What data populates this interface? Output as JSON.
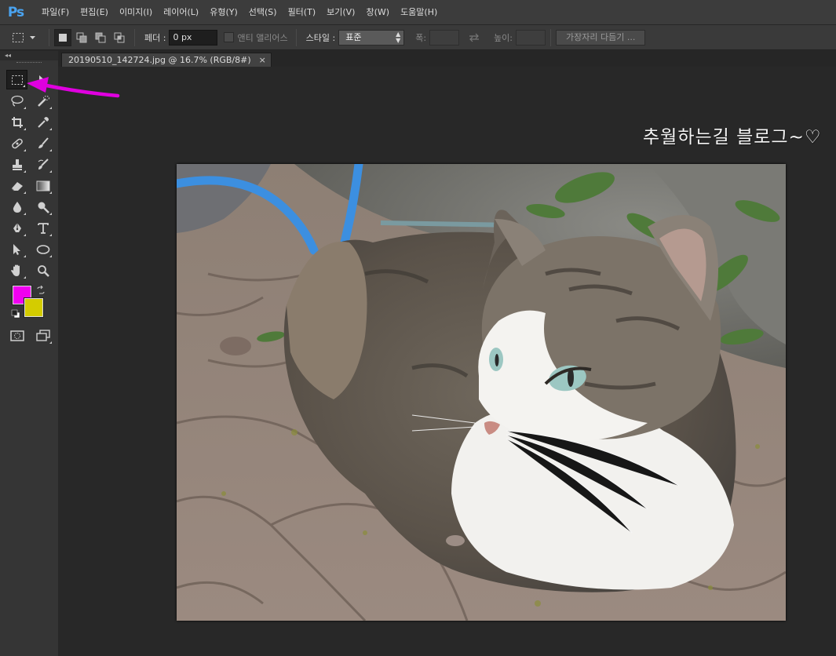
{
  "app": {
    "logo": "Ps"
  },
  "menu": [
    {
      "label": "파일(F)"
    },
    {
      "label": "편집(E)"
    },
    {
      "label": "이미지(I)"
    },
    {
      "label": "레이어(L)"
    },
    {
      "label": "유형(Y)"
    },
    {
      "label": "선택(S)"
    },
    {
      "label": "필터(T)"
    },
    {
      "label": "보기(V)"
    },
    {
      "label": "창(W)"
    },
    {
      "label": "도움말(H)"
    }
  ],
  "options": {
    "feather_label": "페더 :",
    "feather_value": "0 px",
    "antialias_label": "앤티 앨리어스",
    "style_label": "스타일 :",
    "style_value": "표준",
    "width_label": "폭:",
    "height_label": "높이:",
    "refine_edge_label": "가장자리 다듬기 ..."
  },
  "document": {
    "tab_title": "20190510_142724.jpg @ 16.7% (RGB/8#)",
    "tab_close": "×",
    "watermark": "추월하는길 블로그~♡"
  },
  "colors": {
    "foreground": "#f000f0",
    "background": "#d4cc00",
    "arrow": "#e000e0"
  },
  "icons": {
    "marquee": "rect-marquee-icon",
    "move": "move-icon",
    "lasso": "lasso-icon",
    "quick_select": "quick-selection-icon",
    "crop": "crop-icon",
    "eyedropper": "eyedropper-icon",
    "healing": "healing-brush-icon",
    "brush": "brush-icon",
    "stamp": "clone-stamp-icon",
    "history_brush": "history-brush-icon",
    "eraser": "eraser-icon",
    "gradient": "gradient-icon",
    "blur": "blur-icon",
    "dodge": "dodge-icon",
    "pen": "pen-icon",
    "type": "type-icon",
    "path_select": "path-selection-icon",
    "ellipse": "ellipse-icon",
    "hand": "hand-icon",
    "zoom": "zoom-icon",
    "quick_mask": "quick-mask-icon",
    "screen_mode": "screen-mode-icon"
  }
}
